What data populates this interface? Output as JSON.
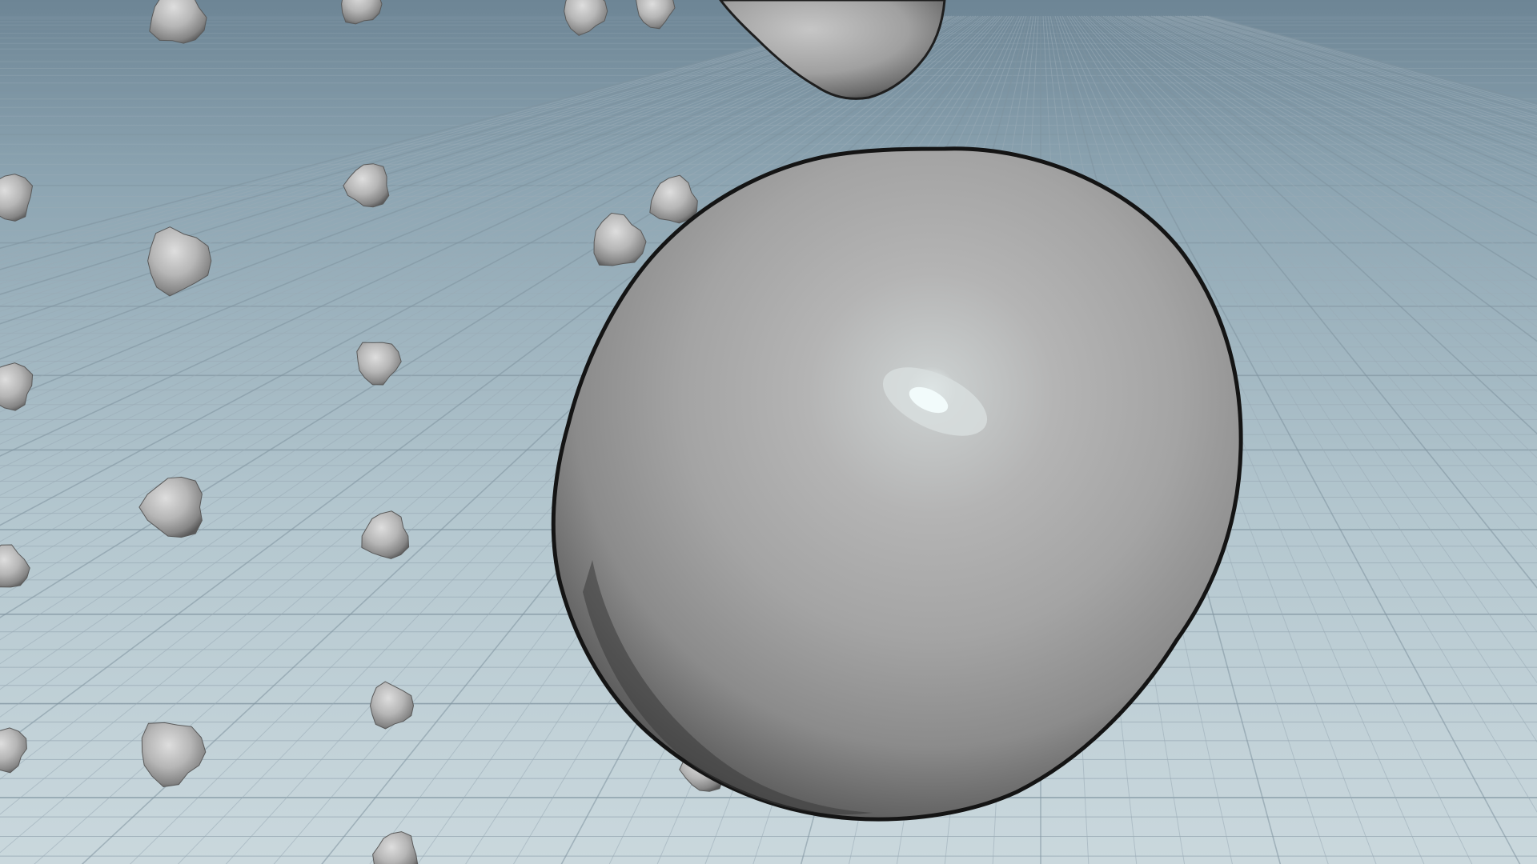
{
  "viewport": {
    "view": "perspective",
    "shading": "smooth-shaded",
    "colors": {
      "background_top": "#6d8595",
      "background_horizon": "#8fa7b4",
      "background_bottom": "#c8d6dc",
      "grid_line": "#9aabb6",
      "grid_major_line": "#7f939f",
      "object_light": "#c9c9c9",
      "object_mid": "#a3a3a3",
      "object_dark": "#4e4e4e",
      "object_shadow": "#1c1c1c",
      "specular": "#eaf7f8"
    }
  },
  "scene": {
    "objects": [
      {
        "name": "large-boulder",
        "kind": "noisy-sphere"
      },
      {
        "name": "top-boulder",
        "kind": "noisy-sphere"
      },
      {
        "name": "small-particles",
        "kind": "noisy-sphere-instances",
        "count": 24
      }
    ]
  }
}
